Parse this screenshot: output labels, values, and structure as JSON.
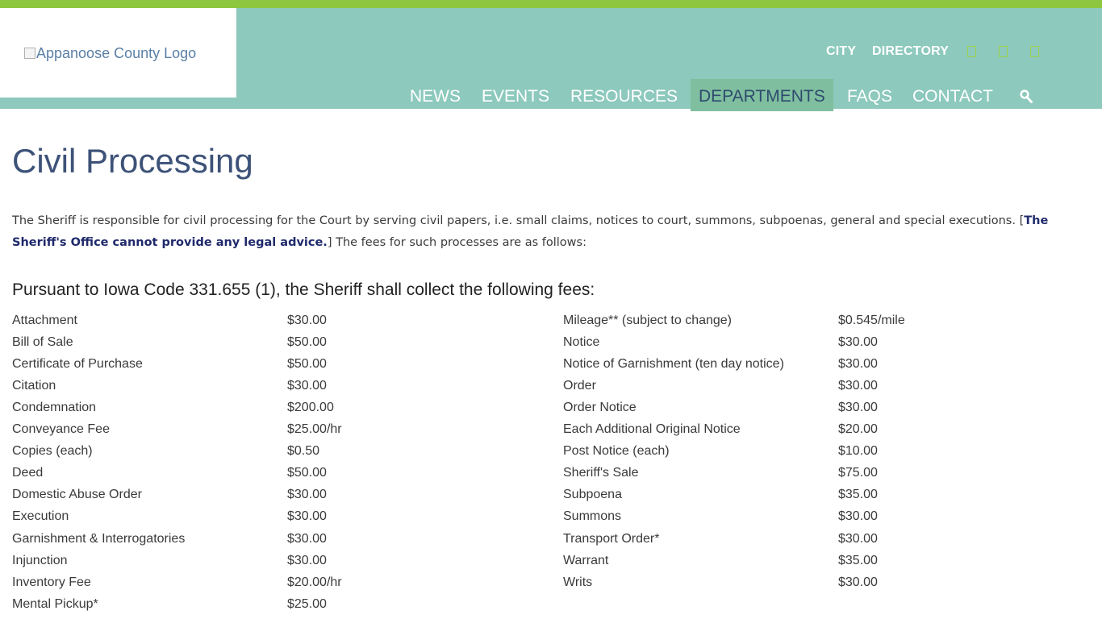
{
  "header": {
    "logo_alt": "Appanoose County Logo",
    "utility_links": [
      "CITY",
      "DIRECTORY"
    ],
    "social_icons": [
      "facebook-icon",
      "twitter-icon",
      "rss-icon"
    ],
    "nav": [
      {
        "label": "NEWS",
        "active": false
      },
      {
        "label": "EVENTS",
        "active": false
      },
      {
        "label": "RESOURCES",
        "active": false
      },
      {
        "label": "DEPARTMENTS",
        "active": true
      },
      {
        "label": "FAQS",
        "active": false
      },
      {
        "label": "CONTACT",
        "active": false
      }
    ],
    "search_icon": "search-icon",
    "colors": {
      "header_bg": "#8dc9bd",
      "top_bar": "#8dc63f",
      "active_nav_bg": "#7fbf9f",
      "title": "#3d5278"
    }
  },
  "page": {
    "title": "Civil Processing",
    "intro_before": "The Sheriff is responsible for civil processing for the Court by serving civil papers, i.e. small claims, notices to court, summons, subpoenas, general and special executions. [",
    "intro_legal": "The Sheriff's Office cannot provide any legal advice.",
    "intro_after": "] The fees for such processes are as follows:",
    "fees_heading": "Pursuant to Iowa Code 331.655 (1), the Sheriff shall collect the following fees:",
    "fees_left": [
      {
        "name": "Attachment",
        "amount": "$30.00"
      },
      {
        "name": "Bill of Sale",
        "amount": "$50.00"
      },
      {
        "name": "Certificate of Purchase",
        "amount": "$50.00"
      },
      {
        "name": "Citation",
        "amount": "$30.00"
      },
      {
        "name": "Condemnation",
        "amount": "$200.00"
      },
      {
        "name": "Conveyance Fee",
        "amount": "$25.00/hr"
      },
      {
        "name": "Copies (each)",
        "amount": "$0.50"
      },
      {
        "name": "Deed",
        "amount": "$50.00"
      },
      {
        "name": "Domestic Abuse Order",
        "amount": "$30.00"
      },
      {
        "name": "Execution",
        "amount": "$30.00"
      },
      {
        "name": "Garnishment & Interrogatories",
        "amount": "$30.00"
      },
      {
        "name": "Injunction",
        "amount": "$30.00"
      },
      {
        "name": "Inventory Fee",
        "amount": "$20.00/hr"
      },
      {
        "name": "Mental Pickup*",
        "amount": "$25.00"
      }
    ],
    "fees_right": [
      {
        "name": "Mileage** (subject to change)",
        "amount": "$0.545/mile"
      },
      {
        "name": "Notice",
        "amount": "$30.00"
      },
      {
        "name": "Notice of Garnishment (ten day notice)",
        "amount": "$30.00"
      },
      {
        "name": "Order",
        "amount": "$30.00"
      },
      {
        "name": "Order Notice",
        "amount": "$30.00"
      },
      {
        "name": "Each Additional Original Notice",
        "amount": "$20.00"
      },
      {
        "name": "Post Notice (each)",
        "amount": "$10.00"
      },
      {
        "name": "Sheriff's Sale",
        "amount": "$75.00"
      },
      {
        "name": "Subpoena",
        "amount": "$35.00"
      },
      {
        "name": "Summons",
        "amount": "$30.00"
      },
      {
        "name": "Transport Order*",
        "amount": "$30.00"
      },
      {
        "name": "Warrant",
        "amount": "$35.00"
      },
      {
        "name": "Writs",
        "amount": "$30.00"
      }
    ]
  }
}
